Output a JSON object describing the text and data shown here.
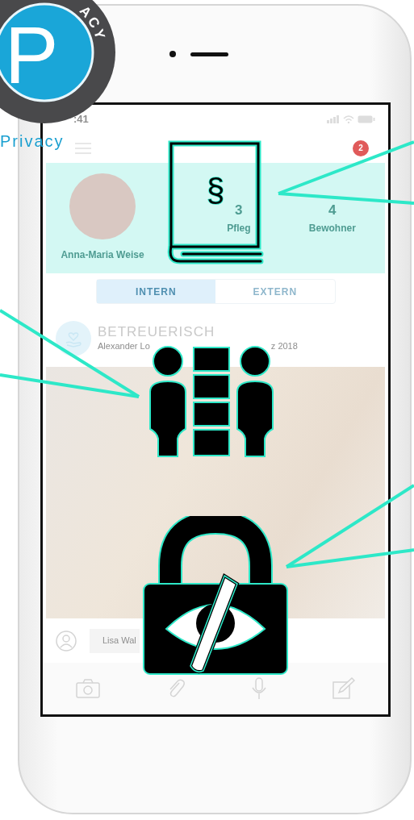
{
  "badge": {
    "letter": "P",
    "ring_text": "ACY",
    "caption": "Privacy"
  },
  "status_bar": {
    "time": ":41"
  },
  "header": {
    "notification_count": "2"
  },
  "profile": {
    "name": "Anna-Maria Weise",
    "stats": [
      {
        "value": "3",
        "label": "Pfleg"
      },
      {
        "value": "4",
        "label": "Bewohner"
      }
    ]
  },
  "tabs": [
    {
      "label": "INTERN",
      "selected": true
    },
    {
      "label": "EXTERN",
      "selected": false
    }
  ],
  "post": {
    "title": "BETREUERISCH",
    "meta_parts": [
      "Alexander Lo",
      "z 2018"
    ]
  },
  "comment": {
    "parts": [
      "Lisa Wal"
    ]
  },
  "book_symbol": "§"
}
